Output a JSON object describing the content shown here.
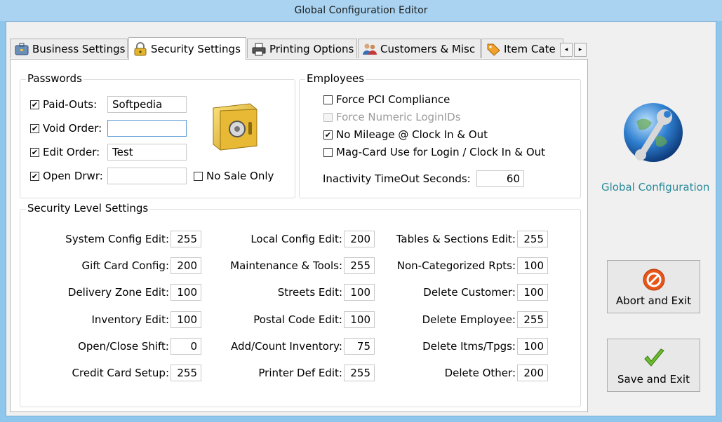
{
  "window": {
    "title": "Global Configuration Editor"
  },
  "tabs": [
    {
      "label": "Business Settings",
      "icon": "briefcase-icon"
    },
    {
      "label": "Security Settings",
      "icon": "padlock-icon"
    },
    {
      "label": "Printing Options",
      "icon": "printer-icon"
    },
    {
      "label": "Customers & Misc",
      "icon": "people-icon"
    },
    {
      "label": "Item Cate",
      "icon": "tag-icon"
    }
  ],
  "tab_scroll": {
    "left": "◂",
    "right": "▸"
  },
  "passwords": {
    "title": "Passwords",
    "rows": [
      {
        "label": "Paid-Outs:",
        "checked": true,
        "value": "Softpedia"
      },
      {
        "label": "Void Order:",
        "checked": true,
        "value": ""
      },
      {
        "label": "Edit Order:",
        "checked": true,
        "value": "Test"
      },
      {
        "label": "Open Drwr:",
        "checked": true,
        "value": ""
      }
    ],
    "no_sale_only": {
      "label": "No Sale Only",
      "checked": false
    },
    "safe_icon": "safe-icon"
  },
  "employees": {
    "title": "Employees",
    "options": [
      {
        "label": "Force PCI Compliance",
        "checked": false,
        "enabled": true
      },
      {
        "label": "Force Numeric LoginIDs",
        "checked": false,
        "enabled": false
      },
      {
        "label": "No Mileage @ Clock In & Out",
        "checked": true,
        "enabled": true
      },
      {
        "label": "Mag-Card Use for Login / Clock In & Out",
        "checked": false,
        "enabled": true
      }
    ],
    "timeout_label": "Inactivity TimeOut Seconds:",
    "timeout_value": "60"
  },
  "security_levels": {
    "title": "Security Level Settings",
    "col1": [
      {
        "label": "System Config Edit:",
        "value": "255"
      },
      {
        "label": "Gift Card Config:",
        "value": "200"
      },
      {
        "label": "Delivery Zone Edit:",
        "value": "100"
      },
      {
        "label": "Inventory Edit:",
        "value": "100"
      },
      {
        "label": "Open/Close Shift:",
        "value": "0"
      },
      {
        "label": "Credit Card Setup:",
        "value": "255"
      }
    ],
    "col2": [
      {
        "label": "Local Config Edit:",
        "value": "200"
      },
      {
        "label": "Maintenance & Tools:",
        "value": "255"
      },
      {
        "label": "Streets Edit:",
        "value": "100"
      },
      {
        "label": "Postal Code Edit:",
        "value": "100"
      },
      {
        "label": "Add/Count Inventory:",
        "value": "75"
      },
      {
        "label": "Printer Def Edit:",
        "value": "255"
      }
    ],
    "col3": [
      {
        "label": "Tables & Sections Edit:",
        "value": "255"
      },
      {
        "label": "Non-Categorized Rpts:",
        "value": "100"
      },
      {
        "label": "Delete Customer:",
        "value": "100"
      },
      {
        "label": "Delete Employee:",
        "value": "255"
      },
      {
        "label": "Delete Itms/Tpgs:",
        "value": "100"
      },
      {
        "label": "Delete Other:",
        "value": "200"
      }
    ]
  },
  "sidebar": {
    "logo_icon": "globe-wrench-icon",
    "logo_caption": "Global Configuration",
    "abort_label": "Abort and Exit",
    "abort_icon": "no-entry-icon",
    "save_label": "Save and Exit",
    "save_icon": "checkmark-icon"
  },
  "colors": {
    "title_bar": "#a9d3f1",
    "caption": "#2a8a9a",
    "abort_icon": "#e8551a",
    "save_icon": "#6cbb2e"
  }
}
